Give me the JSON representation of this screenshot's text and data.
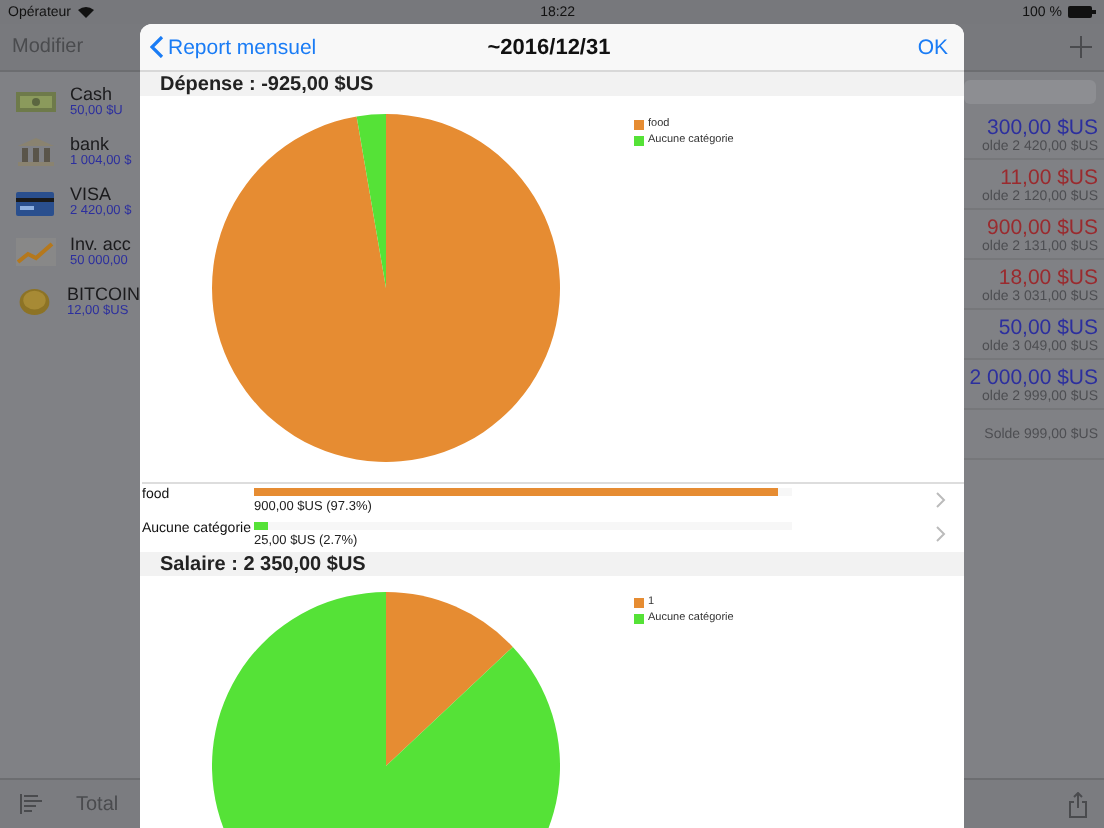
{
  "status_bar": {
    "carrier": "Opérateur",
    "time": "18:22",
    "battery": "100 %"
  },
  "nav_bar": {
    "left": "Modifier"
  },
  "accounts": [
    {
      "kind": "cash",
      "name": "Cash",
      "amount": "50,00 $U"
    },
    {
      "kind": "bank",
      "name": "bank",
      "amount": "1 004,00 $"
    },
    {
      "kind": "card",
      "name": "VISA",
      "amount": "2 420,00 $"
    },
    {
      "kind": "investment",
      "name": "Inv. acc",
      "amount": "50 000,00"
    },
    {
      "kind": "coin",
      "name": "BITCOIN",
      "amount": "12,00 $US"
    }
  ],
  "transactions": [
    {
      "amount": "300,00 $US",
      "color": "#2c2f9e",
      "balance": "olde 2 420,00 $US"
    },
    {
      "amount": "11,00 $US",
      "color": "#9a2a2e",
      "balance": "olde 2 120,00 $US"
    },
    {
      "amount": "900,00 $US",
      "color": "#9a2a2e",
      "balance": "olde 2 131,00 $US"
    },
    {
      "amount": "18,00 $US",
      "color": "#9a2a2e",
      "balance": "olde 3 031,00 $US"
    },
    {
      "amount": "50,00 $US",
      "color": "#2c2f9e",
      "balance": "olde 3 049,00 $US"
    },
    {
      "amount": "2 000,00 $US",
      "color": "#2c2f9e",
      "balance": "olde 2 999,00 $US"
    }
  ],
  "last_balance": "Solde 999,00 $US",
  "toolbar": {
    "label": "Total"
  },
  "report": {
    "back": "Report mensuel",
    "title": "~2016/12/31",
    "done": "OK",
    "sections": [
      {
        "kind": "chart",
        "title": "Dépense : -925,00 $US",
        "legend": [
          {
            "color": "#e68c32"
          },
          {
            "color": "#55e237"
          }
        ],
        "chart_data": {
          "type": "pie",
          "categories": [
            "food",
            "Aucune catégorie"
          ],
          "values": [
            97.3,
            2.7
          ]
        },
        "rows": [
          {
            "name": "food",
            "amount": "900,00 $US (97.3%)",
            "level": 0.973
          },
          {
            "name": "Aucune catégorie",
            "amount": "25,00 $US (2.7%)",
            "level": 0.027
          }
        ]
      },
      {
        "kind": "picture",
        "title": "Salaire : 2 350,00 $US",
        "legend": [
          {
            "label": "1",
            "color": "#e68c32"
          },
          {
            "label": "Aucune catégorie",
            "color": "#55e237"
          }
        ]
      }
    ]
  }
}
